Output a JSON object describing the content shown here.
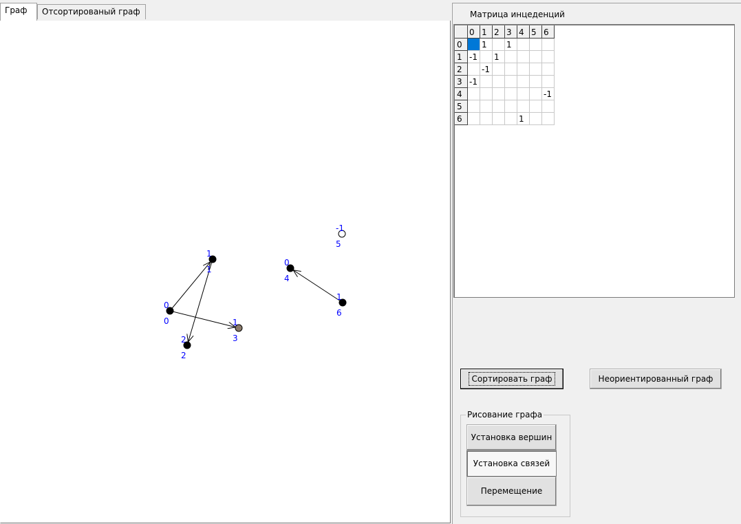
{
  "tabs": [
    {
      "label": "Граф",
      "active": true
    },
    {
      "label": "Отсортированый граф",
      "active": false
    }
  ],
  "matrix": {
    "title": "Матрица инцеденций",
    "columns": [
      "0",
      "1",
      "2",
      "3",
      "4",
      "5",
      "6"
    ],
    "rows": [
      {
        "label": "0",
        "cells": [
          "",
          "1",
          "",
          "1",
          "",
          "",
          ""
        ]
      },
      {
        "label": "1",
        "cells": [
          "-1",
          "",
          "1",
          "",
          "",
          "",
          ""
        ]
      },
      {
        "label": "2",
        "cells": [
          "",
          "-1",
          "",
          "",
          "",
          "",
          ""
        ]
      },
      {
        "label": "3",
        "cells": [
          "-1",
          "",
          "",
          "",
          "",
          "",
          ""
        ]
      },
      {
        "label": "4",
        "cells": [
          "",
          "",
          "",
          "",
          "",
          "",
          "-1"
        ]
      },
      {
        "label": "5",
        "cells": [
          "",
          "",
          "",
          "",
          "",
          "",
          ""
        ]
      },
      {
        "label": "6",
        "cells": [
          "",
          "",
          "",
          "",
          "1",
          "",
          ""
        ]
      }
    ],
    "selected_cell": {
      "row": 0,
      "col": 0
    }
  },
  "buttons": {
    "sort": "Сортировать граф",
    "undirected": "Неориентированный граф"
  },
  "drawing_group": {
    "title": "Рисование графа",
    "set_vertices": "Установка вершин",
    "set_edges": "Установка связей",
    "move": "Перемещение"
  },
  "graph": {
    "vertices": [
      {
        "id": "0",
        "top_label": "0",
        "bottom_label": "0",
        "color": "#000000",
        "filled": true
      },
      {
        "id": "1",
        "top_label": "1",
        "bottom_label": "1",
        "color": "#000000",
        "filled": true
      },
      {
        "id": "2",
        "top_label": "2",
        "bottom_label": "2",
        "color": "#000000",
        "filled": true
      },
      {
        "id": "3",
        "top_label": "1",
        "bottom_label": "3",
        "color": "#8b7b6b",
        "filled": true
      },
      {
        "id": "4",
        "top_label": "0",
        "bottom_label": "4",
        "color": "#000000",
        "filled": true
      },
      {
        "id": "5",
        "top_label": "-1",
        "bottom_label": "5",
        "color": "#ffffff",
        "filled": false
      },
      {
        "id": "6",
        "top_label": "1",
        "bottom_label": "6",
        "color": "#000000",
        "filled": true
      }
    ],
    "edges": [
      {
        "from": "0",
        "to": "1"
      },
      {
        "from": "0",
        "to": "3"
      },
      {
        "from": "1",
        "to": "2"
      },
      {
        "from": "6",
        "to": "4"
      }
    ],
    "label_color": "#0000ff"
  }
}
